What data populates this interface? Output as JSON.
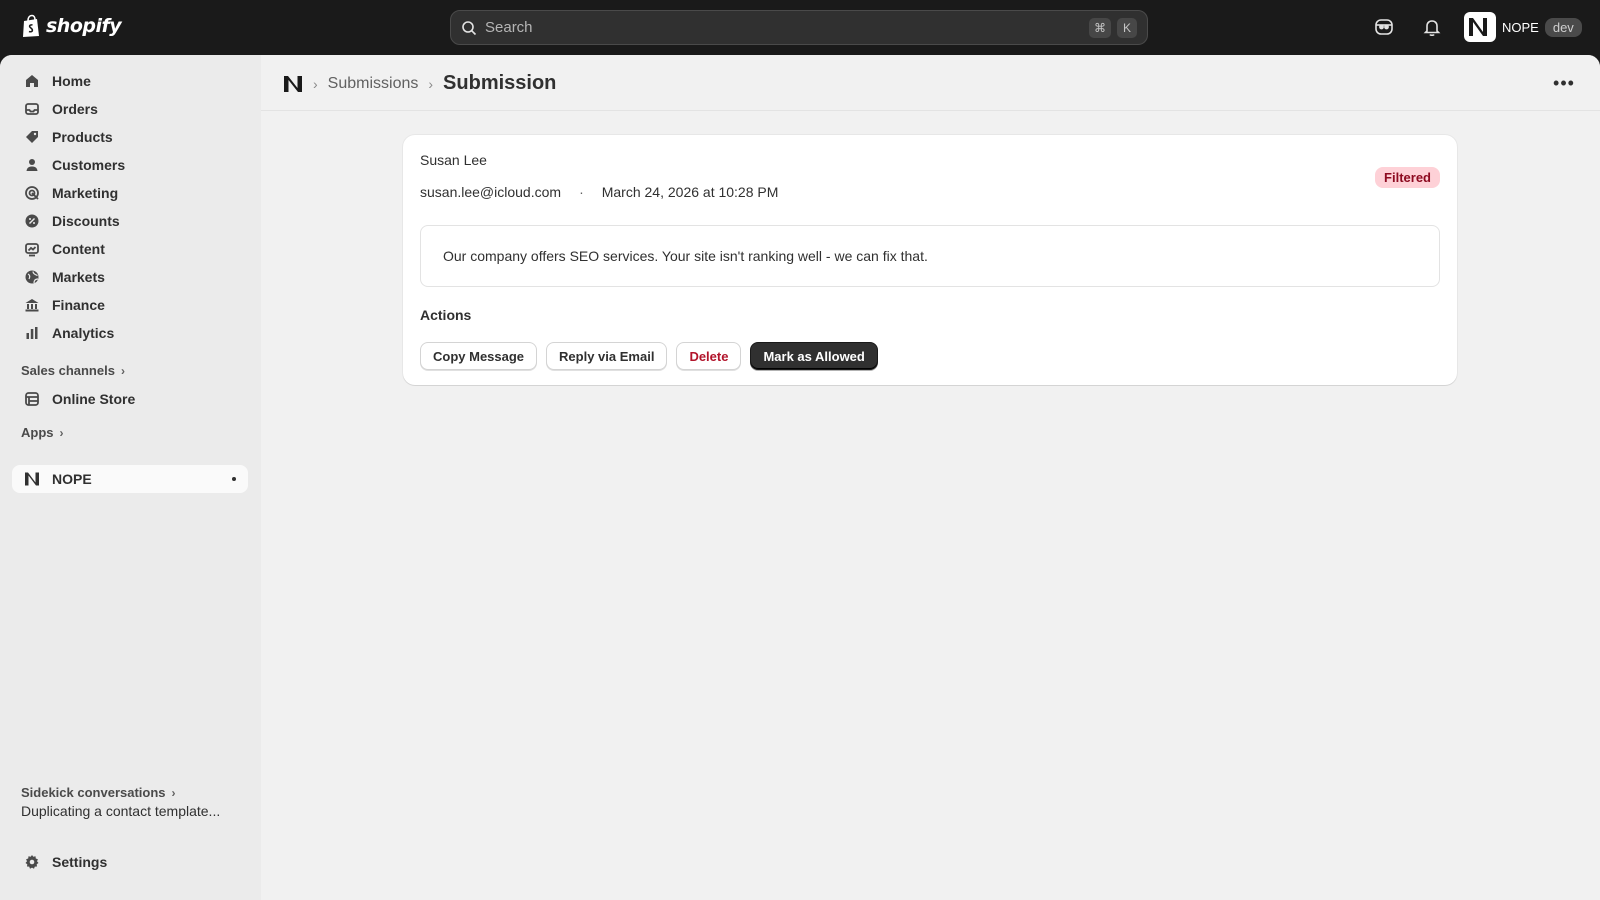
{
  "topbar": {
    "brand": "shopify",
    "search_placeholder": "Search",
    "shortcut_keys": [
      "⌘",
      "K"
    ],
    "store_name": "NOPE",
    "store_badge": "dev"
  },
  "sidebar": {
    "items": [
      {
        "label": "Home",
        "icon": "home-icon"
      },
      {
        "label": "Orders",
        "icon": "inbox-icon"
      },
      {
        "label": "Products",
        "icon": "tag-icon"
      },
      {
        "label": "Customers",
        "icon": "person-icon"
      },
      {
        "label": "Marketing",
        "icon": "target-icon"
      },
      {
        "label": "Discounts",
        "icon": "discount-icon"
      },
      {
        "label": "Content",
        "icon": "content-icon"
      },
      {
        "label": "Markets",
        "icon": "globe-icon"
      },
      {
        "label": "Finance",
        "icon": "bank-icon"
      },
      {
        "label": "Analytics",
        "icon": "chart-icon"
      }
    ],
    "sales_channels_label": "Sales channels",
    "online_store_label": "Online Store",
    "apps_label": "Apps",
    "app_item_label": "NOPE",
    "sidekick_label": "Sidekick conversations",
    "sidekick_item": "Duplicating a contact template...",
    "settings_label": "Settings"
  },
  "page": {
    "breadcrumb_link": "Submissions",
    "title": "Submission"
  },
  "submission": {
    "name": "Susan Lee",
    "email": "susan.lee@icloud.com",
    "separator": "·",
    "date": "March 24, 2026 at 10:28 PM",
    "status": "Filtered",
    "message": "Our company offers SEO services. Your site isn't ranking well - we can fix that.",
    "actions_title": "Actions",
    "buttons": {
      "copy": "Copy Message",
      "reply": "Reply via Email",
      "delete": "Delete",
      "allow": "Mark as Allowed"
    }
  },
  "colors": {
    "topbar_bg": "#1a1a1a",
    "sidebar_bg": "#ebebeb",
    "main_bg": "#f1f1f1",
    "badge_bg": "#fed1d7",
    "badge_text": "#8e0b21",
    "danger_text": "#b2142b",
    "primary_button": "#303030"
  }
}
